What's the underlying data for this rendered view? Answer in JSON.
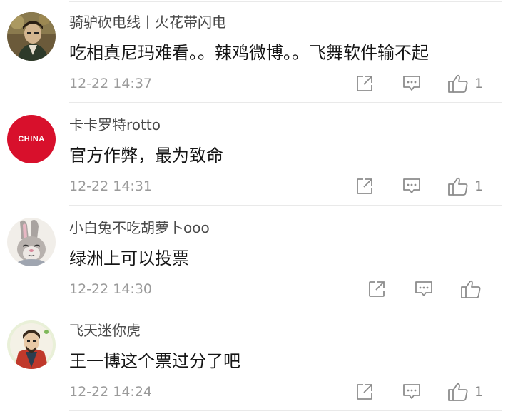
{
  "comments": [
    {
      "username": "骑驴砍电线丨火花带闪电",
      "text": "吃相真尼玛难看。。辣鸡微博。。飞舞软件输不起",
      "time": "12-22 14:37",
      "likes": "1",
      "avatar_icon": "painted-man-avatar"
    },
    {
      "username": "卡卡罗特rotto",
      "text": "官方作弊，最为致命",
      "time": "12-22 14:31",
      "likes": "1",
      "avatar_icon": "china-red-badge-avatar",
      "avatar_text": "CHINA"
    },
    {
      "username": "小白兔不吃胡萝卜ooo",
      "text": "绿洲上可以投票",
      "time": "12-22 14:30",
      "likes": "",
      "avatar_icon": "cartoon-bunny-avatar"
    },
    {
      "username": "飞天迷你虎",
      "text": "王一博这个票过分了吧",
      "time": "12-22 14:24",
      "likes": "1",
      "avatar_icon": "cartoon-wizard-avatar"
    }
  ],
  "icons": {
    "share": "share-icon",
    "reply": "comment-icon",
    "like": "thumbs-up-icon"
  },
  "colors": {
    "icon_gray": "#8c8c8c",
    "time_gray": "#9a9a9a",
    "china_red": "#d8102c"
  }
}
